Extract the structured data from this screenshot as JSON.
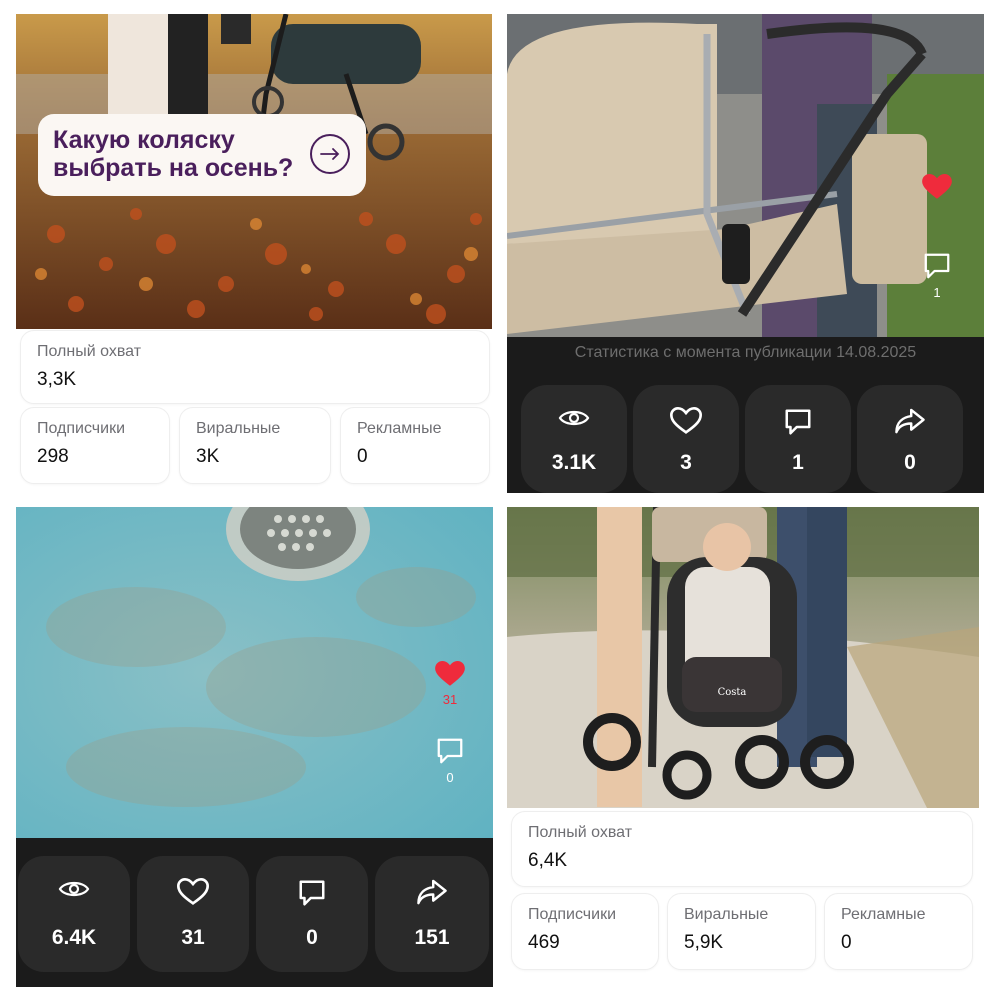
{
  "panel1": {
    "banner_text": "Какую коляску\nвыбрать на осень?",
    "full_reach": {
      "label": "Полный охват",
      "value": "3,3K"
    },
    "subscribers": {
      "label": "Подписчики",
      "value": "298"
    },
    "viral": {
      "label": "Виральные",
      "value": "3K"
    },
    "ads": {
      "label": "Рекламные",
      "value": "0"
    }
  },
  "panel2": {
    "caption": "Статистика с момента публикации 14.08.2025",
    "side": {
      "likes": "",
      "comments": "1"
    },
    "views": "3.1K",
    "likes": "3",
    "comments": "1",
    "shares": "0"
  },
  "panel3": {
    "side": {
      "likes": "31",
      "comments": "0"
    },
    "views": "6.4K",
    "likes": "31",
    "comments": "0",
    "shares": "151"
  },
  "panel4": {
    "brand": "Costa",
    "full_reach": {
      "label": "Полный охват",
      "value": "6,4K"
    },
    "subscribers": {
      "label": "Подписчики",
      "value": "469"
    },
    "viral": {
      "label": "Виральные",
      "value": "5,9K"
    },
    "ads": {
      "label": "Рекламные",
      "value": "0"
    }
  },
  "colors": {
    "heart": "#ef2b3c",
    "dark_bg": "#1b1b1b",
    "tile_bg": "#2a2a2a",
    "banner_text": "#4a1f5c"
  }
}
